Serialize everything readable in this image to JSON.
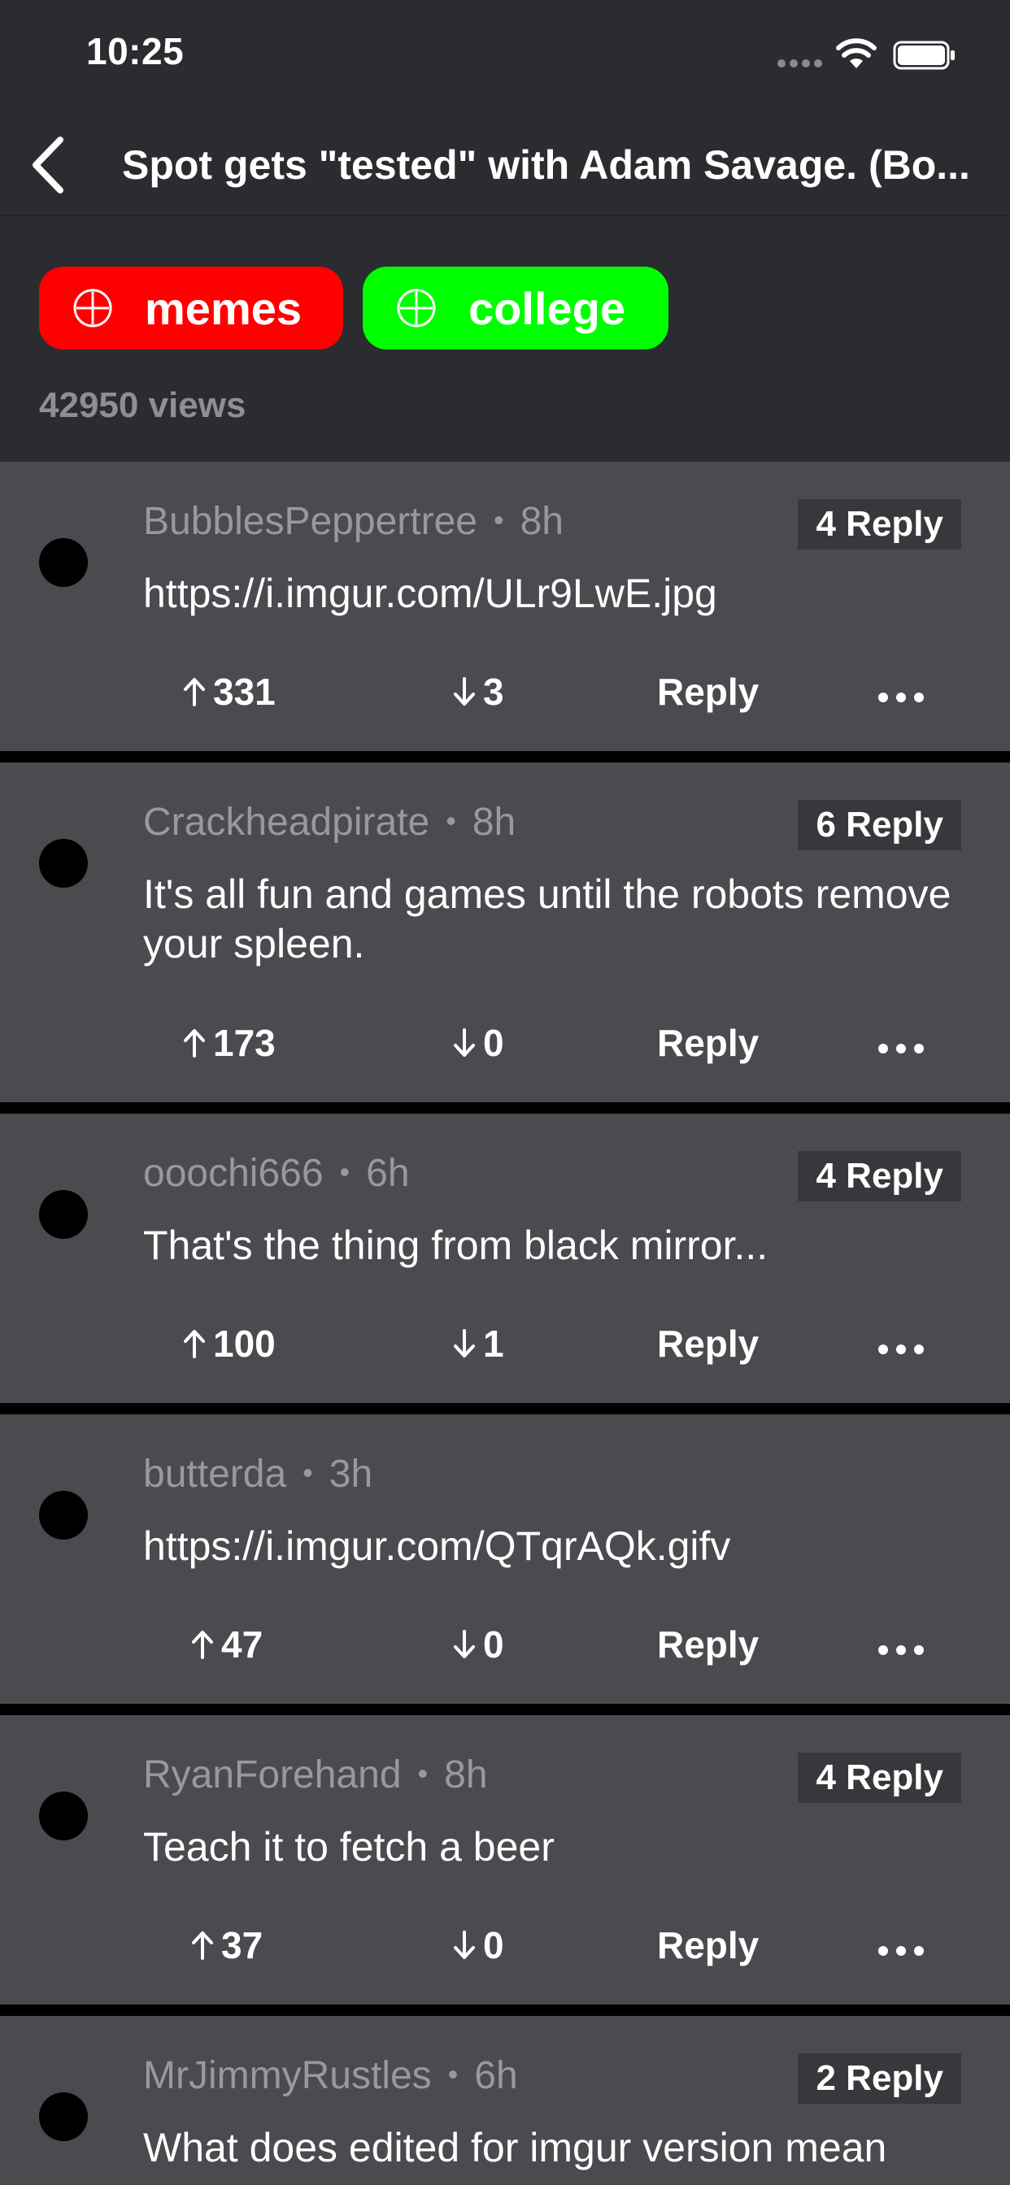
{
  "status_bar": {
    "time": "10:25"
  },
  "nav": {
    "title": "Spot gets \"tested\" with Adam Savage. (Bo..."
  },
  "tags": [
    {
      "label": "memes",
      "color": "#ff0000"
    },
    {
      "label": "college",
      "color": "#00ff00"
    }
  ],
  "views": "42950 views",
  "comments": [
    {
      "author": "BubblesPeppertree",
      "time": "8h",
      "replies": "4 Reply",
      "text": "https://i.imgur.com/ULr9LwE.jpg",
      "upvotes": "331",
      "downvotes": "3",
      "reply_label": "Reply"
    },
    {
      "author": "Crackheadpirate",
      "time": "8h",
      "replies": "6 Reply",
      "text": "It's all fun and games until the robots remove your spleen.",
      "upvotes": "173",
      "downvotes": "0",
      "reply_label": "Reply"
    },
    {
      "author": "ooochi666",
      "time": "6h",
      "replies": "4 Reply",
      "text": "That's the thing from black mirror...",
      "upvotes": "100",
      "downvotes": "1",
      "reply_label": "Reply"
    },
    {
      "author": "butterda",
      "time": "3h",
      "replies": "",
      "text": "https://i.imgur.com/QTqrAQk.gifv",
      "upvotes": "47",
      "downvotes": "0",
      "reply_label": "Reply"
    },
    {
      "author": "RyanForehand",
      "time": "8h",
      "replies": "4 Reply",
      "text": "Teach it to fetch a beer",
      "upvotes": "37",
      "downvotes": "0",
      "reply_label": "Reply"
    },
    {
      "author": "MrJimmyRustles",
      "time": "6h",
      "replies": "2 Reply",
      "text": "What does edited for imgur version mean",
      "upvotes": "",
      "downvotes": "",
      "reply_label": ""
    }
  ]
}
